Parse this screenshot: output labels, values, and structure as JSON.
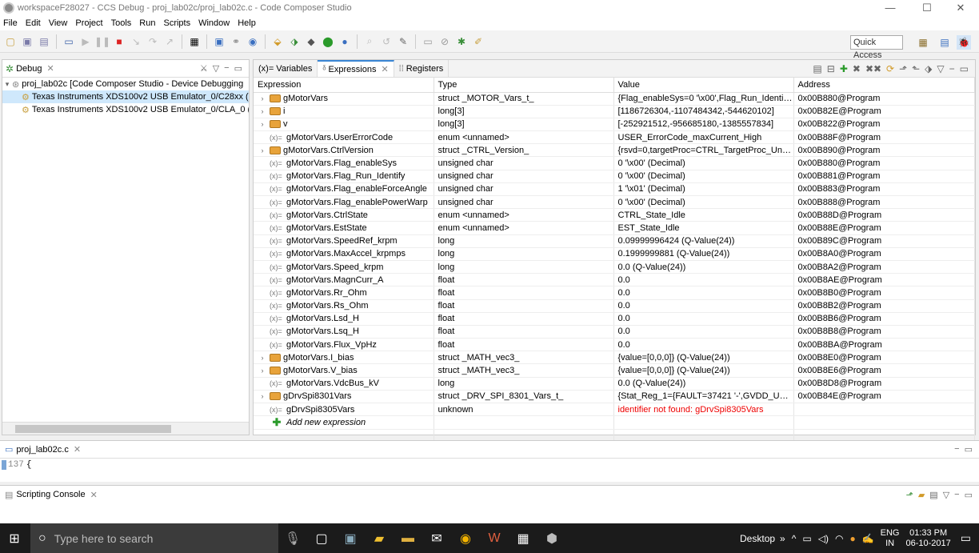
{
  "window": {
    "title": "workspaceF28027 - CCS Debug - proj_lab02c/proj_lab02c.c - Code Composer Studio",
    "min": "—",
    "max": "☐",
    "close": "✕"
  },
  "menu": [
    "File",
    "Edit",
    "View",
    "Project",
    "Tools",
    "Run",
    "Scripts",
    "Window",
    "Help"
  ],
  "toolbar": {
    "quick_access": "Quick Access"
  },
  "debug": {
    "tab_label": "Debug",
    "items": [
      "proj_lab02c [Code Composer Studio - Device Debugging",
      "Texas Instruments XDS100v2 USB Emulator_0/C28xx (",
      "Texas Instruments XDS100v2 USB Emulator_0/CLA_0 ("
    ]
  },
  "expr": {
    "tabs": [
      "(x)= Variables",
      "Expressions",
      "Registers"
    ],
    "columns": [
      "Expression",
      "Type",
      "Value",
      "Address"
    ],
    "rows": [
      {
        "kind": "struct",
        "expand": true,
        "name": "gMotorVars",
        "type": "struct _MOTOR_Vars_t_",
        "value": "{Flag_enableSys=0 '\\x00',Flag_Run_Identify=...",
        "address": "0x00B880@Program"
      },
      {
        "kind": "struct",
        "expand": true,
        "name": "i",
        "type": "long[3]",
        "value": "[1186726304,-1107484342,-544620102]",
        "address": "0x00B82E@Program"
      },
      {
        "kind": "struct",
        "expand": true,
        "name": "v",
        "type": "long[3]",
        "value": "[-252921512,-956685180,-1385557834]",
        "address": "0x00B822@Program"
      },
      {
        "kind": "var",
        "expand": false,
        "name": "gMotorVars.UserErrorCode",
        "type": "enum <unnamed>",
        "value": "USER_ErrorCode_maxCurrent_High",
        "address": "0x00B88F@Program"
      },
      {
        "kind": "struct",
        "expand": true,
        "name": "gMotorVars.CtrlVersion",
        "type": "struct _CTRL_Version_",
        "value": "{rsvd=0,targetProc=CTRL_TargetProc_Unkn...",
        "address": "0x00B890@Program"
      },
      {
        "kind": "var",
        "expand": false,
        "name": "gMotorVars.Flag_enableSys",
        "type": "unsigned char",
        "value": "0 '\\x00' (Decimal)",
        "address": "0x00B880@Program"
      },
      {
        "kind": "var",
        "expand": false,
        "name": "gMotorVars.Flag_Run_Identify",
        "type": "unsigned char",
        "value": "0 '\\x00' (Decimal)",
        "address": "0x00B881@Program"
      },
      {
        "kind": "var",
        "expand": false,
        "name": "gMotorVars.Flag_enableForceAngle",
        "type": "unsigned char",
        "value": "1 '\\x01' (Decimal)",
        "address": "0x00B883@Program"
      },
      {
        "kind": "var",
        "expand": false,
        "name": "gMotorVars.Flag_enablePowerWarp",
        "type": "unsigned char",
        "value": "0 '\\x00' (Decimal)",
        "address": "0x00B888@Program"
      },
      {
        "kind": "var",
        "expand": false,
        "name": "gMotorVars.CtrlState",
        "type": "enum <unnamed>",
        "value": "CTRL_State_Idle",
        "address": "0x00B88D@Program"
      },
      {
        "kind": "var",
        "expand": false,
        "name": "gMotorVars.EstState",
        "type": "enum <unnamed>",
        "value": "EST_State_Idle",
        "address": "0x00B88E@Program"
      },
      {
        "kind": "var",
        "expand": false,
        "name": "gMotorVars.SpeedRef_krpm",
        "type": "long",
        "value": "0.09999996424 (Q-Value(24))",
        "address": "0x00B89C@Program"
      },
      {
        "kind": "var",
        "expand": false,
        "name": "gMotorVars.MaxAccel_krpmps",
        "type": "long",
        "value": "0.1999999881 (Q-Value(24))",
        "address": "0x00B8A0@Program"
      },
      {
        "kind": "var",
        "expand": false,
        "name": "gMotorVars.Speed_krpm",
        "type": "long",
        "value": "0.0 (Q-Value(24))",
        "address": "0x00B8A2@Program"
      },
      {
        "kind": "var",
        "expand": false,
        "name": "gMotorVars.MagnCurr_A",
        "type": "float",
        "value": "0.0",
        "address": "0x00B8AE@Program"
      },
      {
        "kind": "var",
        "expand": false,
        "name": "gMotorVars.Rr_Ohm",
        "type": "float",
        "value": "0.0",
        "address": "0x00B8B0@Program"
      },
      {
        "kind": "var",
        "expand": false,
        "name": "gMotorVars.Rs_Ohm",
        "type": "float",
        "value": "0.0",
        "address": "0x00B8B2@Program"
      },
      {
        "kind": "var",
        "expand": false,
        "name": "gMotorVars.Lsd_H",
        "type": "float",
        "value": "0.0",
        "address": "0x00B8B6@Program"
      },
      {
        "kind": "var",
        "expand": false,
        "name": "gMotorVars.Lsq_H",
        "type": "float",
        "value": "0.0",
        "address": "0x00B8B8@Program"
      },
      {
        "kind": "var",
        "expand": false,
        "name": "gMotorVars.Flux_VpHz",
        "type": "float",
        "value": "0.0",
        "address": "0x00B8BA@Program"
      },
      {
        "kind": "struct",
        "expand": true,
        "name": "gMotorVars.I_bias",
        "type": "struct _MATH_vec3_",
        "value": "{value=[0,0,0]} (Q-Value(24))",
        "address": "0x00B8E0@Program"
      },
      {
        "kind": "struct",
        "expand": true,
        "name": "gMotorVars.V_bias",
        "type": "struct _MATH_vec3_",
        "value": "{value=[0,0,0]} (Q-Value(24))",
        "address": "0x00B8E6@Program"
      },
      {
        "kind": "var",
        "expand": false,
        "name": "gMotorVars.VdcBus_kV",
        "type": "long",
        "value": "0.0 (Q-Value(24))",
        "address": "0x00B8D8@Program"
      },
      {
        "kind": "struct",
        "expand": true,
        "name": "gDrvSpi8301Vars",
        "type": "struct _DRV_SPI_8301_Vars_t_",
        "value": "{Stat_Reg_1={FAULT=37421 '-',GVDD_UV=38...",
        "address": "0x00B84E@Program"
      },
      {
        "kind": "var",
        "expand": false,
        "name": "gDrvSpi8305Vars",
        "type": "unknown",
        "value": "identifier not found: gDrvSpi8305Vars",
        "address": "",
        "error": true
      }
    ],
    "add_new": "Add new expression"
  },
  "editor": {
    "tab_label": "proj_lab02c.c",
    "line_no": "137",
    "line_text": "{"
  },
  "console": {
    "tab_label": "Scripting Console"
  },
  "taskbar": {
    "search_placeholder": "Type here to search",
    "desktop_label": "Desktop",
    "lang_top": "ENG",
    "lang_bottom": "IN",
    "time": "01:33 PM",
    "date": "06-10-2017"
  },
  "colors": {
    "accent": "#3a86d4",
    "error": "#e00000",
    "taskbar": "#1b1b1b"
  }
}
